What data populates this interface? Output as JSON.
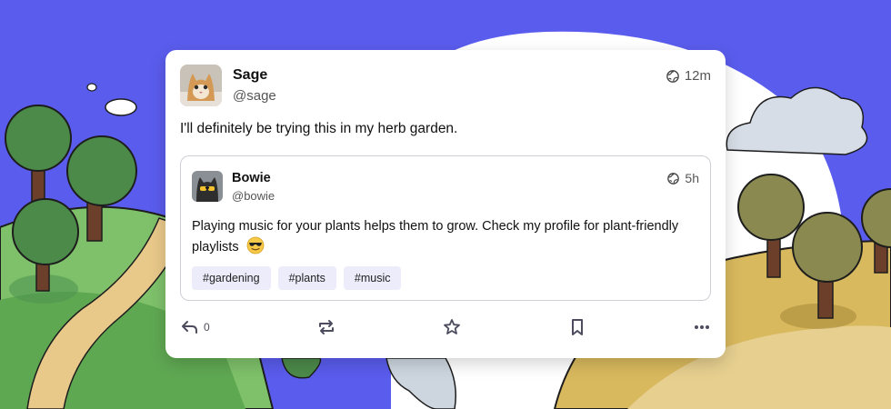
{
  "post": {
    "author_name": "Sage",
    "author_handle": "@sage",
    "visibility_icon": "globe-icon",
    "time": "12m",
    "text": "I'll definitely be trying this in my herb garden."
  },
  "quoted": {
    "author_name": "Bowie",
    "author_handle": "@bowie",
    "visibility_icon": "globe-icon",
    "time": "5h",
    "text": "Playing music for your plants helps them to grow. Check my profile for plant-friendly playlists",
    "emoji": "sunglasses-emoji",
    "tags": [
      "#gardening",
      "#plants",
      "#music"
    ]
  },
  "actions": {
    "reply_count": "0",
    "reply_icon": "reply-icon",
    "boost_icon": "repost-icon",
    "favourite_icon": "star-icon",
    "bookmark_icon": "bookmark-icon",
    "more_icon": "more-icon"
  },
  "colors": {
    "sky": "#5a5ced",
    "card": "#ffffff",
    "tag_bg": "#ececfa",
    "icon": "#4c4c5e"
  }
}
